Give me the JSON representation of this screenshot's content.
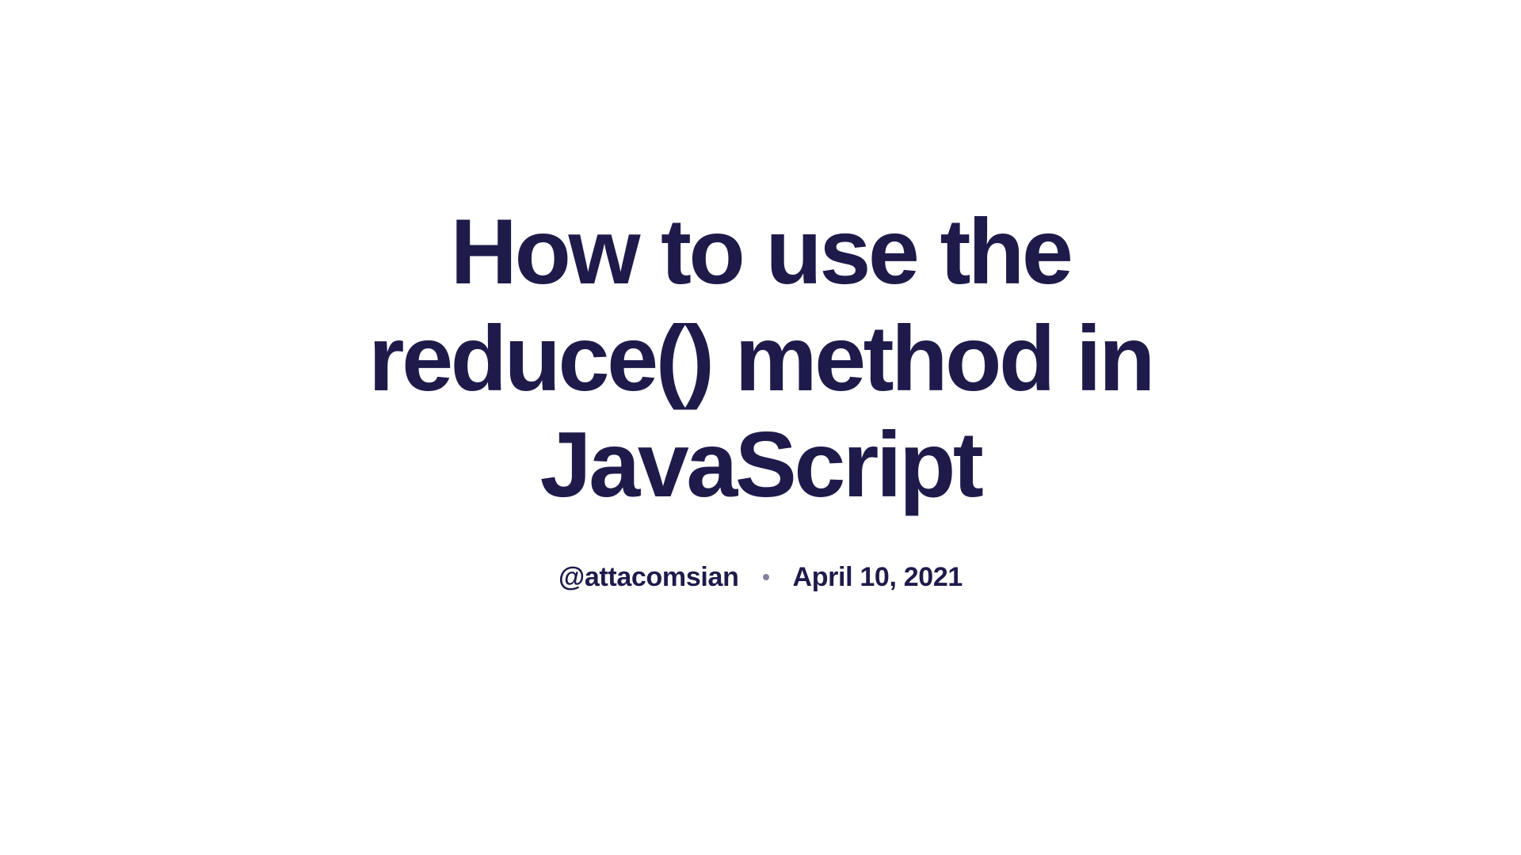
{
  "article": {
    "title": "How to use the reduce() method in JavaScript",
    "author_handle": "@attacomsian",
    "date": "April 10, 2021"
  }
}
